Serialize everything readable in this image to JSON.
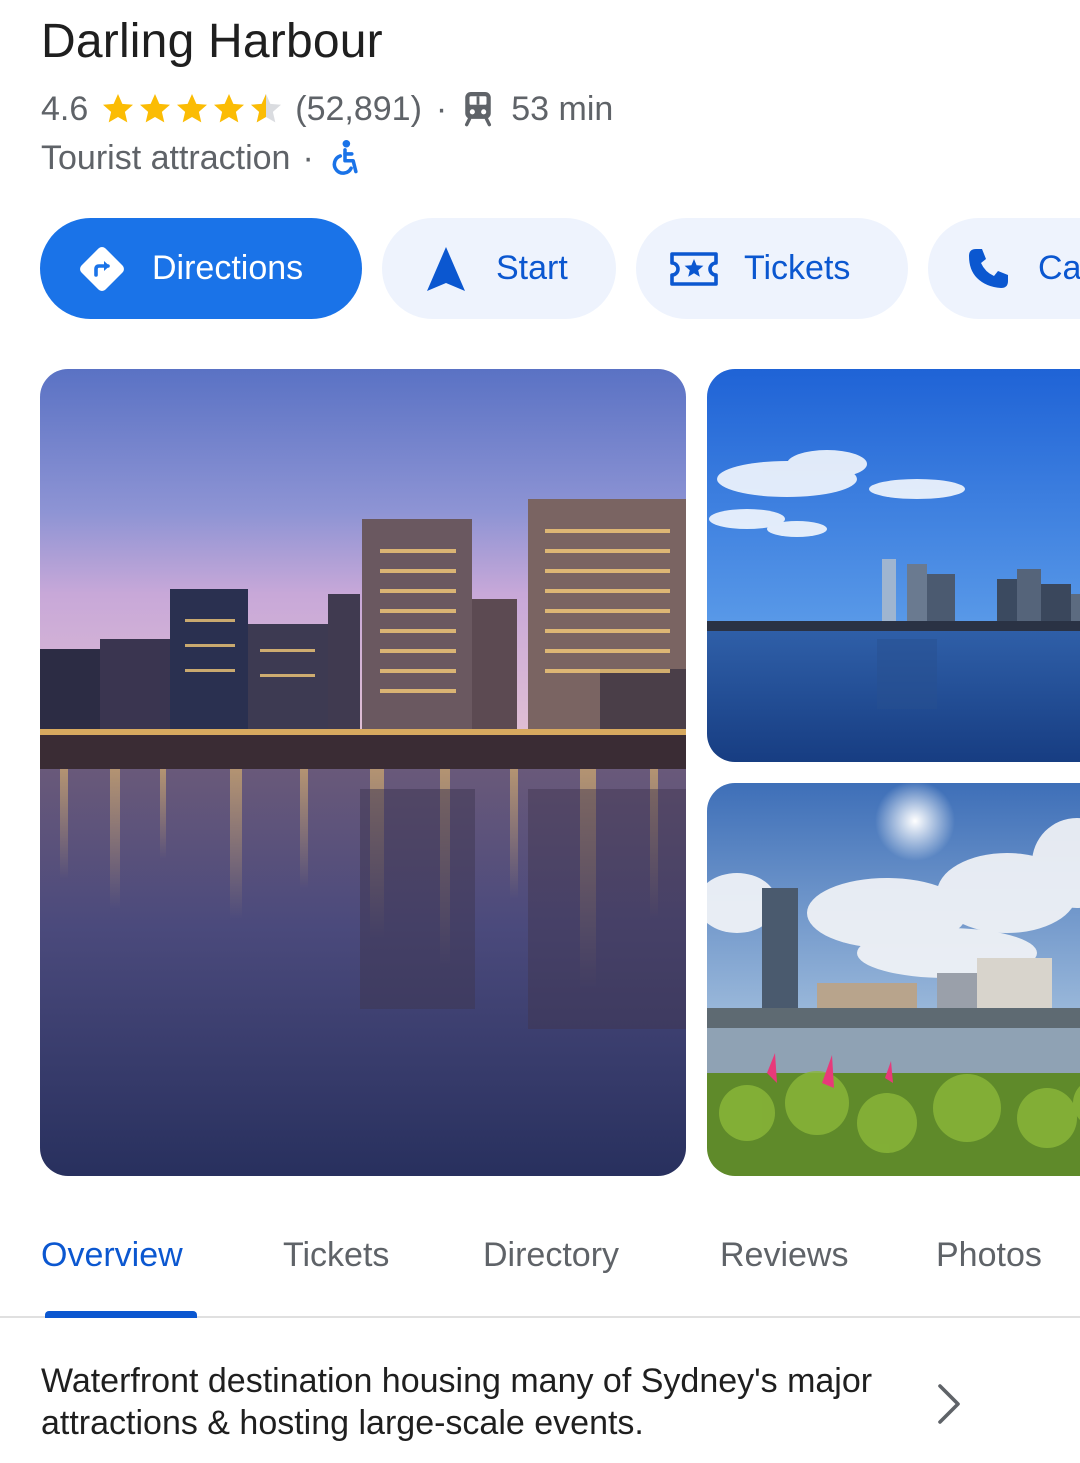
{
  "place": {
    "name": "Darling Harbour",
    "rating": "4.6",
    "stars": 4.5,
    "review_count": "(52,891)",
    "separator": "·",
    "transit_time": "53 min",
    "category": "Tourist attraction",
    "icons": {
      "transit": "train-icon",
      "accessibility": "wheelchair-accessible-icon"
    }
  },
  "actions": [
    {
      "label": "Directions",
      "icon": "directions-icon"
    },
    {
      "label": "Start",
      "icon": "navigation-arrow-icon"
    },
    {
      "label": "Tickets",
      "icon": "ticket-icon"
    },
    {
      "label": "Ca",
      "icon": "phone-icon"
    }
  ],
  "tabs": [
    {
      "label": "Overview",
      "active": true
    },
    {
      "label": "Tickets"
    },
    {
      "label": "Directory"
    },
    {
      "label": "Reviews"
    },
    {
      "label": "Photos"
    }
  ],
  "description": "Waterfront destination housing many of Sydney's major attractions & hosting large-scale events.",
  "colors": {
    "accent": "#1a73e8",
    "accent_text": "#0b57d0",
    "star": "#fbbc04",
    "secondary_text": "#5f6368",
    "chip_bg": "#eef3fd"
  }
}
